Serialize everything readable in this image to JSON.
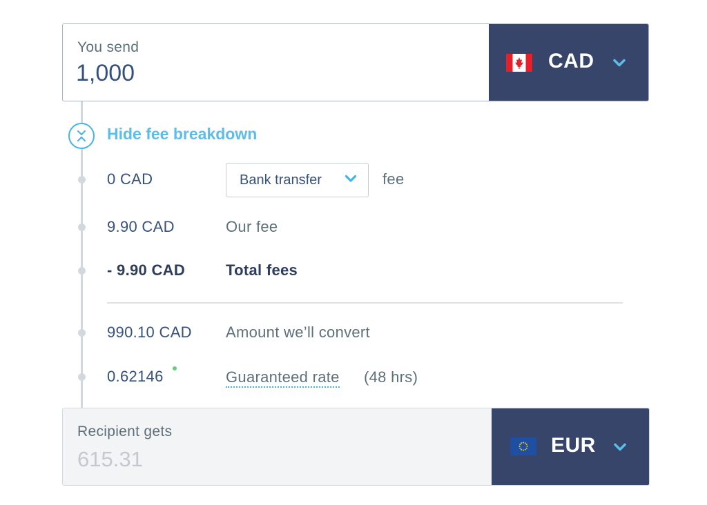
{
  "send": {
    "label": "You send",
    "amount": "1,000",
    "currency": "CAD",
    "flag_icon": "canada-flag-icon"
  },
  "breakdown": {
    "toggle_label": "Hide fee breakdown",
    "rows": [
      {
        "amount": "0 CAD",
        "select_value": "Bank transfer",
        "label": "fee"
      },
      {
        "amount": "9.90 CAD",
        "label": "Our fee"
      },
      {
        "amount": "- 9.90 CAD",
        "label": "Total fees"
      },
      {
        "amount": "990.10 CAD",
        "label": "Amount we’ll convert"
      },
      {
        "amount": "0.62146",
        "label": "Guaranteed rate",
        "label_suffix": "(48 hrs)"
      }
    ]
  },
  "receive": {
    "label": "Recipient gets",
    "amount": "615.31",
    "currency": "EUR",
    "flag_icon": "eu-flag-icon"
  },
  "colors": {
    "navy": "#37456a",
    "accent_blue": "#43b4e7",
    "live_green": "#5fcf80",
    "flag_red": "#e4202b",
    "eu_blue": "#1f4fa3",
    "eu_star": "#f5cc1a"
  }
}
